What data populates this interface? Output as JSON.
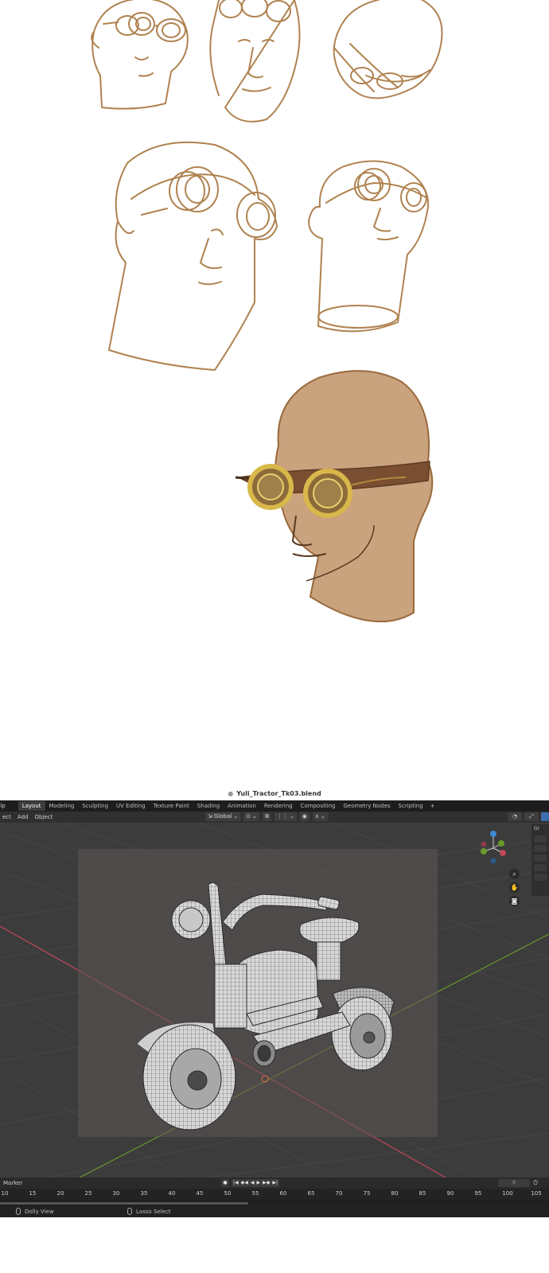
{
  "window": {
    "file_name": "Yuli_Tractor_Tk03.blend"
  },
  "topbar": {
    "help_menu": "elp",
    "workspaces": [
      {
        "label": "Layout",
        "active": true
      },
      {
        "label": "Modeling"
      },
      {
        "label": "Sculpting"
      },
      {
        "label": "UV Editing"
      },
      {
        "label": "Texture Paint"
      },
      {
        "label": "Shading"
      },
      {
        "label": "Animation"
      },
      {
        "label": "Rendering"
      },
      {
        "label": "Compositing"
      },
      {
        "label": "Geometry Nodes"
      },
      {
        "label": "Scripting"
      }
    ],
    "add_workspace": "+"
  },
  "header": {
    "menus": [
      "ect",
      "Add",
      "Object"
    ],
    "transform_orientation": "Global"
  },
  "side_panel": {
    "title": "Gr"
  },
  "timeline": {
    "marker_menu": "Marker",
    "current_frame": "0",
    "ruler_ticks": [
      "10",
      "15",
      "20",
      "25",
      "30",
      "35",
      "40",
      "45",
      "50",
      "55",
      "60",
      "65",
      "70",
      "75",
      "80",
      "85",
      "90",
      "95",
      "100",
      "105"
    ]
  },
  "statusbar": {
    "hint_1": "Dolly View",
    "hint_2": "Lasso Select"
  },
  "colors": {
    "sketch_line": "#b08250",
    "skin_fill": "#c9a27e",
    "goggle_lens": "#d8b84a",
    "strap": "#7a4e30",
    "viewport_bg": "#3c3c3c",
    "active_tab": "#3d3d3d",
    "axis_x": "#c0485a",
    "axis_y": "#6a9a2a",
    "axis_z": "#3d8ad0"
  },
  "icons": [
    "gizmo-axis-icon",
    "zoom-icon",
    "pan-hand-icon",
    "camera-icon",
    "play-icon",
    "mouse-icon"
  ]
}
